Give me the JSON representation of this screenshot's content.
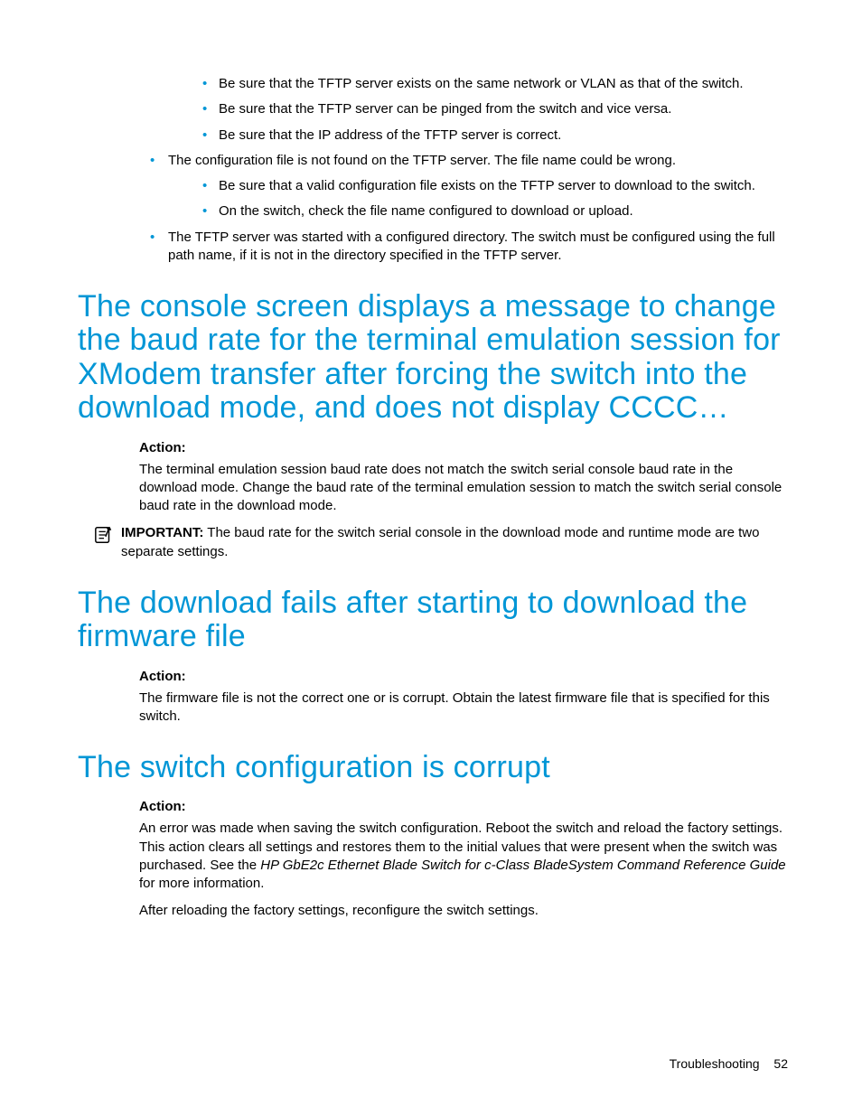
{
  "bullets": {
    "inner1": [
      "Be sure that the TFTP server exists on the same network or VLAN as that of the switch.",
      "Be sure that the TFTP server can be pinged from the switch and vice versa.",
      "Be sure that the IP address of the TFTP server is correct."
    ],
    "outer1": "The configuration file is not found on the TFTP server. The file name could be wrong.",
    "inner2": [
      "Be sure that a valid configuration file exists on the TFTP server to download to the switch.",
      "On the switch, check the file name configured to download or upload."
    ],
    "outer2": "The TFTP server was started with a configured directory. The switch must be configured using the full path name, if it is not in the directory specified in the TFTP server."
  },
  "section1": {
    "heading": "The console screen displays a message to change the baud rate for the terminal emulation session for XModem transfer after forcing the switch into the download mode, and does not display CCCC…",
    "action_label": "Action:",
    "action_body": "The terminal emulation session baud rate does not match the switch serial console baud rate in the download mode. Change the baud rate of the terminal emulation session to match the switch serial console baud rate in the download mode.",
    "important_label": "IMPORTANT:",
    "important_body": "  The baud rate for the switch serial console in the download mode and runtime mode are two separate settings."
  },
  "section2": {
    "heading": "The download fails after starting to download the firmware file",
    "action_label": "Action:",
    "action_body": "The firmware file is not the correct one or is corrupt. Obtain the latest firmware file that is specified for this switch."
  },
  "section3": {
    "heading": "The switch configuration is corrupt",
    "action_label": "Action:",
    "action_body_pre": "An error was made when saving the switch configuration. Reboot the switch and reload the factory settings. This action clears all settings and restores them to the initial values that were present when the switch was purchased. See the ",
    "action_body_italic": "HP GbE2c Ethernet Blade Switch for c-Class BladeSystem Command Reference Guide",
    "action_body_post": " for more information.",
    "after": "After reloading the factory settings, reconfigure the switch settings."
  },
  "footer": {
    "section": "Troubleshooting",
    "page": "52"
  }
}
